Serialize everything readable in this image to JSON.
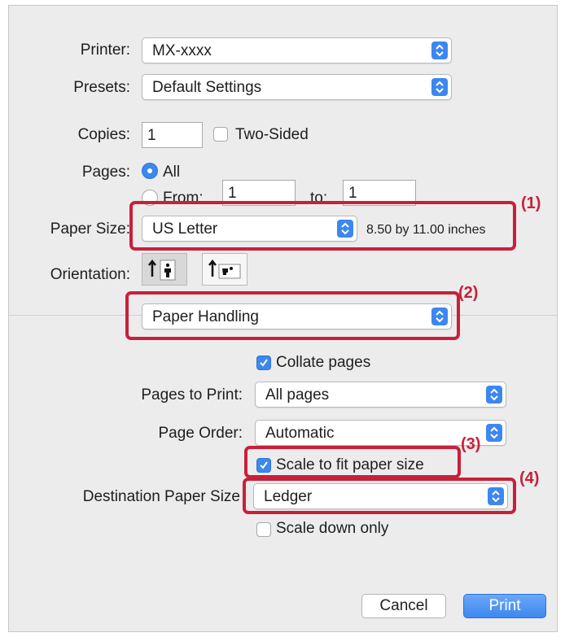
{
  "printer": {
    "label": "Printer:",
    "value": "MX-xxxx"
  },
  "presets": {
    "label": "Presets:",
    "value": "Default Settings"
  },
  "copies": {
    "label": "Copies:",
    "value": "1",
    "two_sided_label": "Two-Sided"
  },
  "pages": {
    "label": "Pages:",
    "all_label": "All",
    "from_label": "From:",
    "from_value": "1",
    "to_label": "to:",
    "to_value": "1"
  },
  "paper_size": {
    "label": "Paper Size:",
    "value": "US Letter",
    "dimensions": "8.50 by 11.00 inches"
  },
  "orientation": {
    "label": "Orientation:",
    "portrait_icon": "portrait-orientation-icon",
    "landscape_icon": "landscape-orientation-icon"
  },
  "section_popup": {
    "value": "Paper Handling"
  },
  "collate": {
    "label": "Collate pages",
    "checked": true
  },
  "pages_to_print": {
    "label": "Pages to Print:",
    "value": "All pages"
  },
  "page_order": {
    "label": "Page Order:",
    "value": "Automatic"
  },
  "scale_fit": {
    "label": "Scale to fit paper size",
    "checked": true
  },
  "destination": {
    "label": "Destination Paper Size",
    "value": "Ledger"
  },
  "scale_down": {
    "label": "Scale down only",
    "checked": false
  },
  "callouts": {
    "c1": "(1)",
    "c2": "(2)",
    "c3": "(3)",
    "c4": "(4)"
  },
  "buttons": {
    "cancel": "Cancel",
    "print": "Print"
  },
  "colors": {
    "accent": "#3d87f0",
    "callout": "#c8203b"
  }
}
